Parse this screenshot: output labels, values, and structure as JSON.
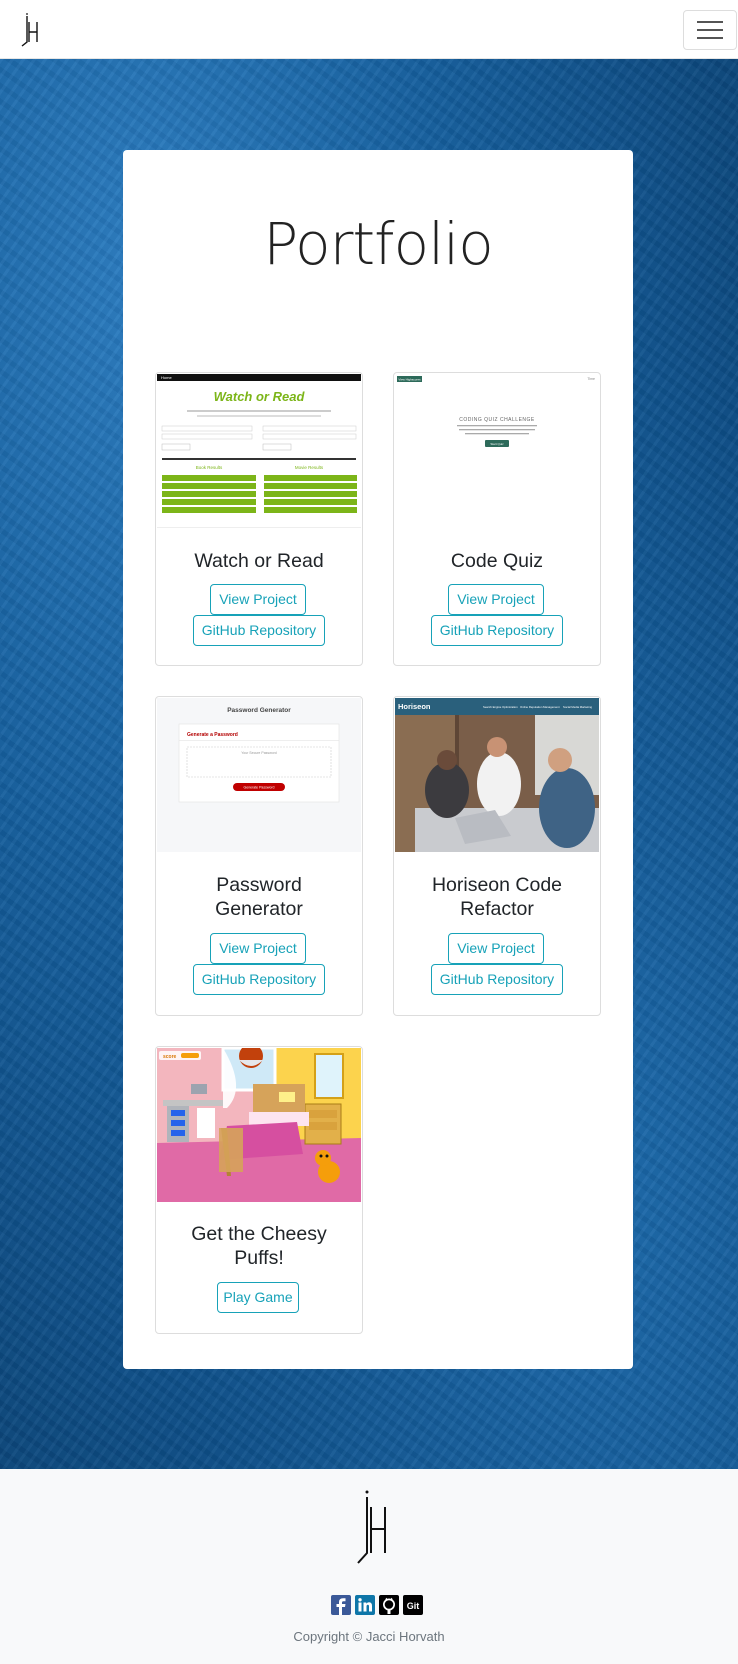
{
  "nav": {
    "logo_text": "jH"
  },
  "portfolio": {
    "title": "Portfolio",
    "projects": [
      {
        "title": "Watch or Read",
        "buttons": [
          "View Project",
          "GitHub Repository"
        ]
      },
      {
        "title": "Code Quiz",
        "buttons": [
          "View Project",
          "GitHub Repository"
        ]
      },
      {
        "title_line1": "Password",
        "title_line2": "Generator",
        "buttons": [
          "View Project",
          "GitHub Repository"
        ]
      },
      {
        "title_line1": "Horiseon Code",
        "title_line2": "Refactor",
        "buttons": [
          "View Project",
          "GitHub Repository"
        ]
      },
      {
        "title_line1": "Get the Cheesy",
        "title_line2": "Puffs!",
        "buttons": [
          "Play Game"
        ]
      }
    ]
  },
  "thumbs": {
    "watch": {
      "nav": "Home",
      "heading": "Watch or Read",
      "left_col": "Book Results",
      "right_col": "Movie Results"
    },
    "quiz": {
      "badge": "View Highscores",
      "timer": "Time",
      "heading": "CODING QUIZ CHALLENGE",
      "start": "Start Quiz"
    },
    "password": {
      "heading": "Password Generator",
      "sub": "Generate a Password",
      "placeholder": "Your Secure Password",
      "button": "Generate Password"
    },
    "horiseon": {
      "brand": "Horiseon",
      "nav1": "Search Engine Optimization",
      "nav2": "Online Reputation Management",
      "nav3": "Social Media Marketing"
    },
    "game": {
      "score_label": "score"
    }
  },
  "footer": {
    "logo_text": "jH",
    "social": [
      {
        "icon": "facebook-icon",
        "color": "#3b5998"
      },
      {
        "icon": "linkedin-icon",
        "color": "#0e76a8"
      },
      {
        "icon": "github-icon",
        "color": "#000000"
      },
      {
        "icon": "git-icon",
        "color": "#000000",
        "label": "Git"
      }
    ],
    "copyright": "Copyright © Jacci Horvath"
  }
}
